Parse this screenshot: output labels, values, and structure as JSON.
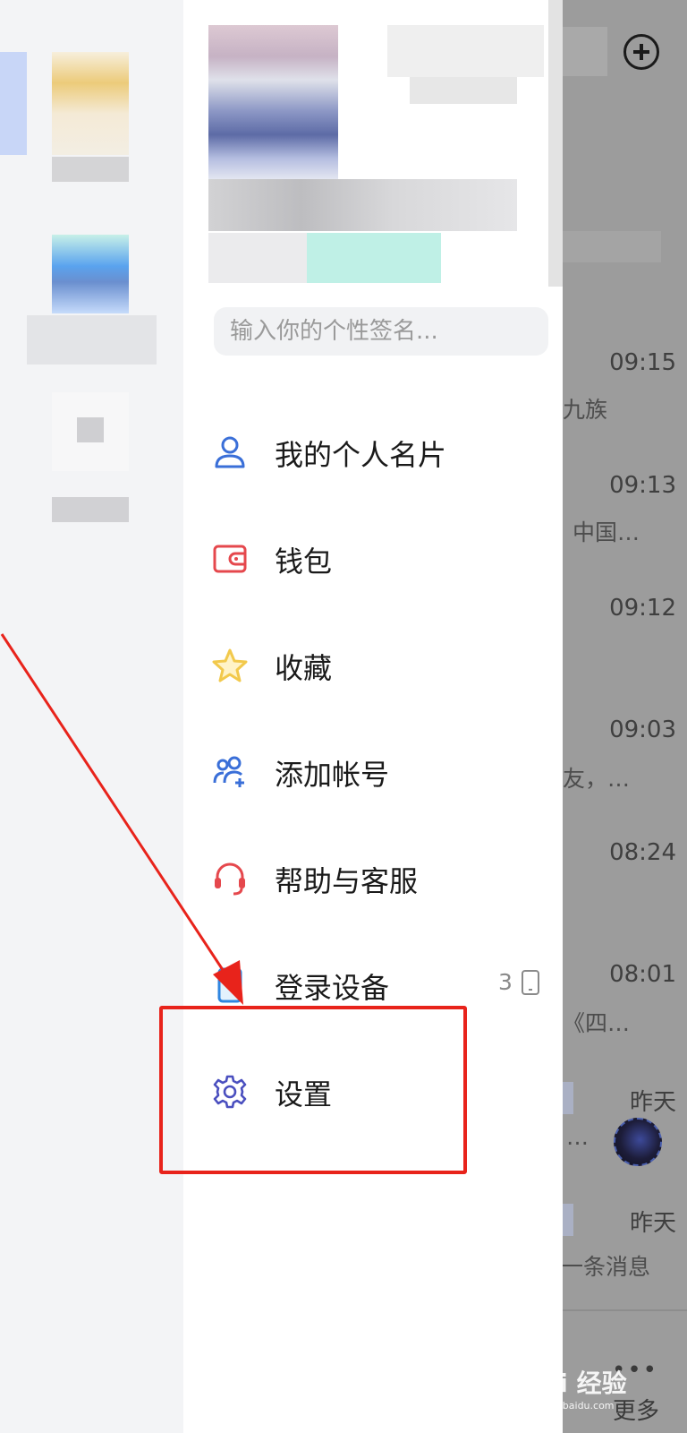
{
  "signature": {
    "placeholder": "输入你的个性签名..."
  },
  "menu": [
    {
      "label": "我的个人名片",
      "icon": "person-card-icon"
    },
    {
      "label": "钱包",
      "icon": "wallet-icon"
    },
    {
      "label": "收藏",
      "icon": "star-icon"
    },
    {
      "label": "添加帐号",
      "icon": "add-account-icon"
    },
    {
      "label": "帮助与客服",
      "icon": "headset-icon"
    },
    {
      "label": "登录设备",
      "icon": "phone-device-icon",
      "count": "3"
    },
    {
      "label": "设置",
      "icon": "gear-icon"
    }
  ],
  "chat_list": {
    "times": [
      "09:15",
      "09:13",
      "09:12",
      "09:03",
      "08:24",
      "08:01",
      "昨天",
      "昨天"
    ],
    "previews": [
      "九族",
      "中国…",
      "友，…",
      "《四…",
      "…",
      "一条消息"
    ],
    "bottom_more": "更多"
  },
  "watermark": {
    "text": "Bai 经验",
    "sub": "jingyan.baidu.com"
  },
  "colors": {
    "accent_blue": "#3a6fd8",
    "annotation_red": "#e8231b",
    "wallet_red": "#e5484d",
    "star_yellow": "#f2c94c"
  }
}
